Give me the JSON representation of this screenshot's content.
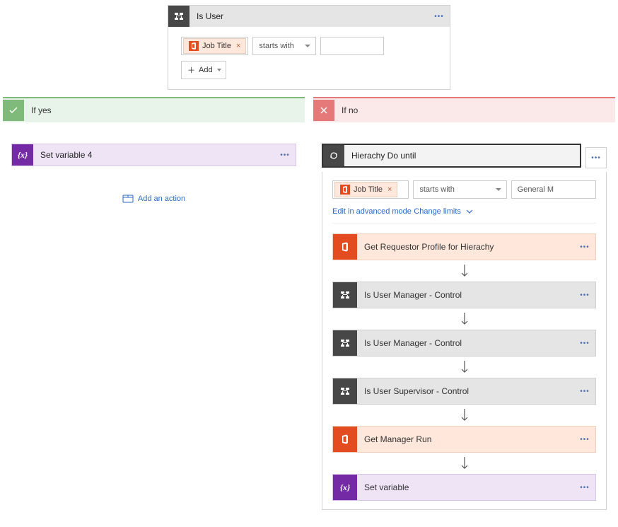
{
  "top": {
    "title": "Is User",
    "chip_label": "Job Title",
    "operator": "starts with",
    "value": "",
    "add_label": "Add"
  },
  "branches": {
    "yes": {
      "label": "If yes",
      "action_title": "Set variable 4",
      "add_action": "Add an action"
    },
    "no": {
      "label": "If no",
      "loop": {
        "title": "Hierachy Do until",
        "chip_label": "Job Title",
        "operator": "starts with",
        "value": "General M",
        "edit_mode": "Edit in advanced mode",
        "change_limits": "Change limits"
      },
      "steps": [
        {
          "kind": "orange",
          "icon": "office",
          "title": "Get Requestor Profile for Hierachy"
        },
        {
          "kind": "gray",
          "icon": "condition",
          "title": "Is User       Manager - Control"
        },
        {
          "kind": "gray",
          "icon": "condition",
          "title": "Is User Manager - Control"
        },
        {
          "kind": "gray",
          "icon": "condition",
          "title": "Is User Supervisor - Control"
        },
        {
          "kind": "orange",
          "icon": "office",
          "title": "Get Manager      Run"
        },
        {
          "kind": "purple",
          "icon": "variable",
          "title": "Set variable"
        }
      ]
    }
  }
}
